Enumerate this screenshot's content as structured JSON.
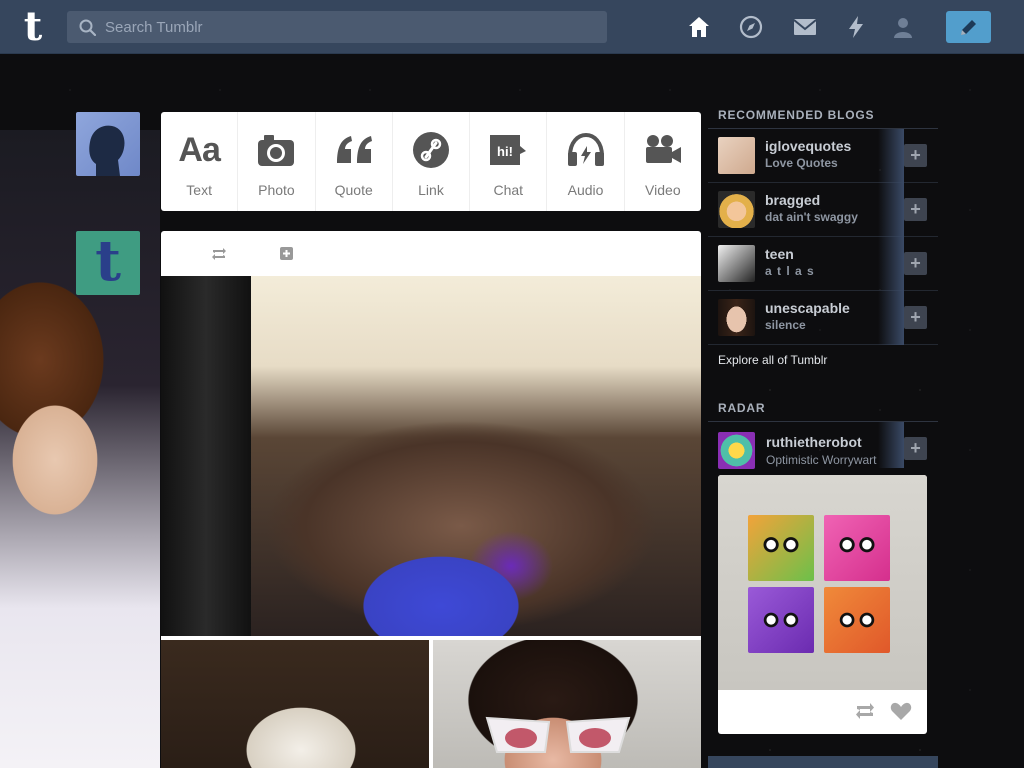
{
  "header": {
    "logo": "t",
    "search_placeholder": "Search Tumblr",
    "nav": [
      "home-icon",
      "explore-icon",
      "inbox-icon",
      "activity-icon",
      "account-icon"
    ],
    "compose_icon": "pencil-icon",
    "accent": "#36465d",
    "compose_color": "#529ecc"
  },
  "composer": {
    "types": [
      {
        "label": "Text",
        "icon": "text-icon"
      },
      {
        "label": "Photo",
        "icon": "camera-icon"
      },
      {
        "label": "Quote",
        "icon": "quote-icon"
      },
      {
        "label": "Link",
        "icon": "link-icon"
      },
      {
        "label": "Chat",
        "icon": "chat-icon"
      },
      {
        "label": "Audio",
        "icon": "headphones-icon"
      },
      {
        "label": "Video",
        "icon": "video-camera-icon"
      }
    ],
    "text_glyph": "Aa",
    "quote_glyph": "66",
    "chat_glyph": "hi!"
  },
  "sidebar": {
    "recommended_title": "RECOMMENDED BLOGS",
    "blogs": [
      {
        "name": "iglovequotes",
        "subtitle": "Love Quotes"
      },
      {
        "name": "bragged",
        "subtitle": "dat ain't swaggy"
      },
      {
        "name": "teen",
        "subtitle": "a t l a s"
      },
      {
        "name": "unescapable",
        "subtitle": "silence"
      }
    ],
    "follow_glyph": "+",
    "explore_link": "Explore all of Tumblr",
    "radar_title": "RADAR",
    "radar_user": {
      "name": "ruthietherobot",
      "subtitle": "Optimistic Worrywart"
    }
  }
}
